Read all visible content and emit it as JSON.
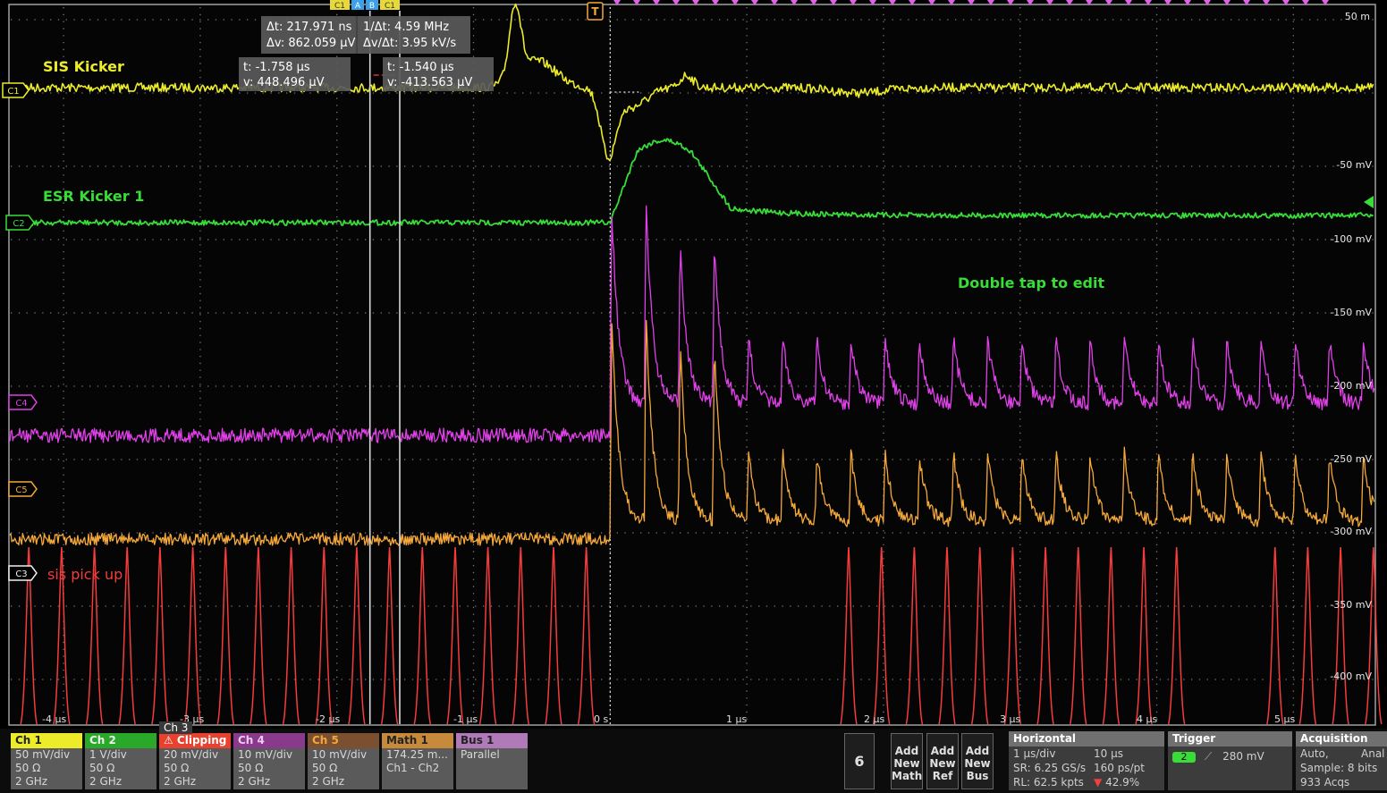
{
  "colors": {
    "ch1": "#ecec2a",
    "ch2": "#38dd38",
    "ch3": "#f43c3c",
    "ch4": "#e040e8",
    "ch5": "#f5a83a",
    "grid": "#7a7a7a",
    "cursor": "#d8d8d8"
  },
  "channels": {
    "ch1": {
      "tag": "C1",
      "label": "SIS Kicker"
    },
    "ch2": {
      "tag": "C2",
      "label": "ESR Kicker 1"
    },
    "ch3": {
      "tag": "C3",
      "label": "sis pick up"
    },
    "ch4": {
      "tag": "C4"
    },
    "ch5": {
      "tag": "C5"
    }
  },
  "trigger_marker": "T",
  "cursor_tags": {
    "c1a": "C1",
    "a": "A",
    "b": "B",
    "c1b": "C1"
  },
  "cursor_readouts": {
    "delta_t": "Δt: 217.971 ns",
    "delta_v": "Δv: 862.059 μV",
    "inv_dt": "1/Δt: 4.59 MHz",
    "dv_dt": "Δv/Δt: 3.95 kV/s",
    "a_t": "t: -1.758 μs",
    "a_v": "v: 448.496 μV",
    "b_t": "t: -1.540 μs",
    "b_v": "v: -413.563 μV"
  },
  "edit_hint": "Double tap to edit",
  "right_scale": [
    "50 m",
    "-50 mV",
    "-100 mV",
    "-150 mV",
    "-200 mV",
    "-250 mV",
    "-300 mV",
    "-350 mV",
    "-400 mV"
  ],
  "time_axis": [
    "-4 μs",
    "-3 μs",
    "-2 μs",
    "-1 μs",
    "0 s",
    "1 μs",
    "2 μs",
    "3 μs",
    "4 μs",
    "5 μs"
  ],
  "badges": [
    {
      "key": "ch1",
      "title": "Ch 1",
      "lines": [
        "50 mV/div",
        "50 Ω",
        "2 GHz"
      ]
    },
    {
      "key": "ch2",
      "title": "Ch 2",
      "lines": [
        "1 V/div",
        "50 Ω",
        "2 GHz"
      ]
    },
    {
      "key": "ch3",
      "title": "⚠ Clipping",
      "tab": "Ch 3",
      "lines": [
        "20 mV/div",
        "50 Ω",
        "2 GHz"
      ]
    },
    {
      "key": "ch4",
      "title": "Ch 4",
      "lines": [
        "10 mV/div",
        "50 Ω",
        "2 GHz"
      ]
    },
    {
      "key": "ch5",
      "title": "Ch 5",
      "lines": [
        "10 mV/div",
        "50 Ω",
        "2 GHz"
      ]
    },
    {
      "key": "math",
      "title": "Math 1",
      "lines": [
        "174.25 m...",
        "Ch1 - Ch2"
      ]
    },
    {
      "key": "bus",
      "title": "Bus 1",
      "lines": [
        "Parallel"
      ]
    }
  ],
  "controls": {
    "count": "6",
    "add_math": "Add New Math",
    "add_ref": "Add New Ref",
    "add_bus": "Add New Bus"
  },
  "horizontal": {
    "title": "Horizontal",
    "scale": "1 μs/div",
    "pos": "10 μs",
    "sr": "SR: 6.25 GS/s",
    "pt": "160 ps/pt",
    "rl": "RL: 62.5 kpts",
    "pct": "42.9%"
  },
  "trigger": {
    "title": "Trigger",
    "src": "2",
    "level": "280 mV"
  },
  "acquisition": {
    "title": "Acquisition",
    "mode": "Auto,",
    "mode2": "Anal",
    "sample": "Sample: 8 bits",
    "acqs": "933 Acqs"
  },
  "plot": {
    "time_range_us": [
      -4.4,
      5.6
    ],
    "ch1_pulse_us": 0.0,
    "ch2_step_start_us": 0.0,
    "ch2_step_end_us": 0.72,
    "ch4_ch5_onset_us": 0.0,
    "ch4_ch5_period_us": 0.25,
    "ch3_period_us": 0.24,
    "ch3_gap_us": [
      0.0,
      1.65
    ],
    "ch3_late_gap_us": [
      4.3,
      4.7
    ],
    "cursor_a_us": -1.758,
    "cursor_b_us": -1.54
  }
}
